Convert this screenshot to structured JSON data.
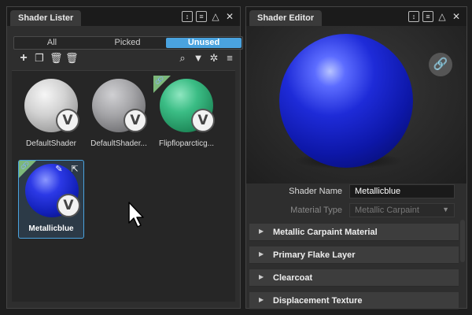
{
  "lister": {
    "title": "Shader Lister",
    "filters": [
      "All",
      "Picked",
      "Unused"
    ],
    "active_filter": "Unused",
    "toolbar_icons": [
      "add-icon",
      "duplicate-icon",
      "delete-unused-icon",
      "delete-icon",
      "search-icon",
      "filter-icon",
      "settings-icon",
      "menu-icon"
    ],
    "tiles": [
      {
        "name": "DefaultShader",
        "color": "#d8d8d8",
        "linked": false,
        "selected": false
      },
      {
        "name": "DefaultShader...",
        "color": "#a8a8ab",
        "linked": false,
        "selected": false
      },
      {
        "name": "Flipfloparcticg...",
        "color": "#2fa36b",
        "linked": true,
        "selected": false
      },
      {
        "name": "Metallicblue",
        "color": "#1e2bd8",
        "linked": true,
        "selected": true
      }
    ]
  },
  "editor": {
    "title": "Shader Editor",
    "shader_name_label": "Shader Name",
    "shader_name_value": "Metallicblue",
    "material_type_label": "Material Type",
    "material_type_value": "Metallic Carpaint",
    "sections": [
      "Metallic Carpaint Material",
      "Primary Flake Layer",
      "Clearcoat",
      "Displacement Texture"
    ]
  },
  "colors": {
    "accent": "#4aa3df",
    "link_corner": "#7cb87a"
  }
}
